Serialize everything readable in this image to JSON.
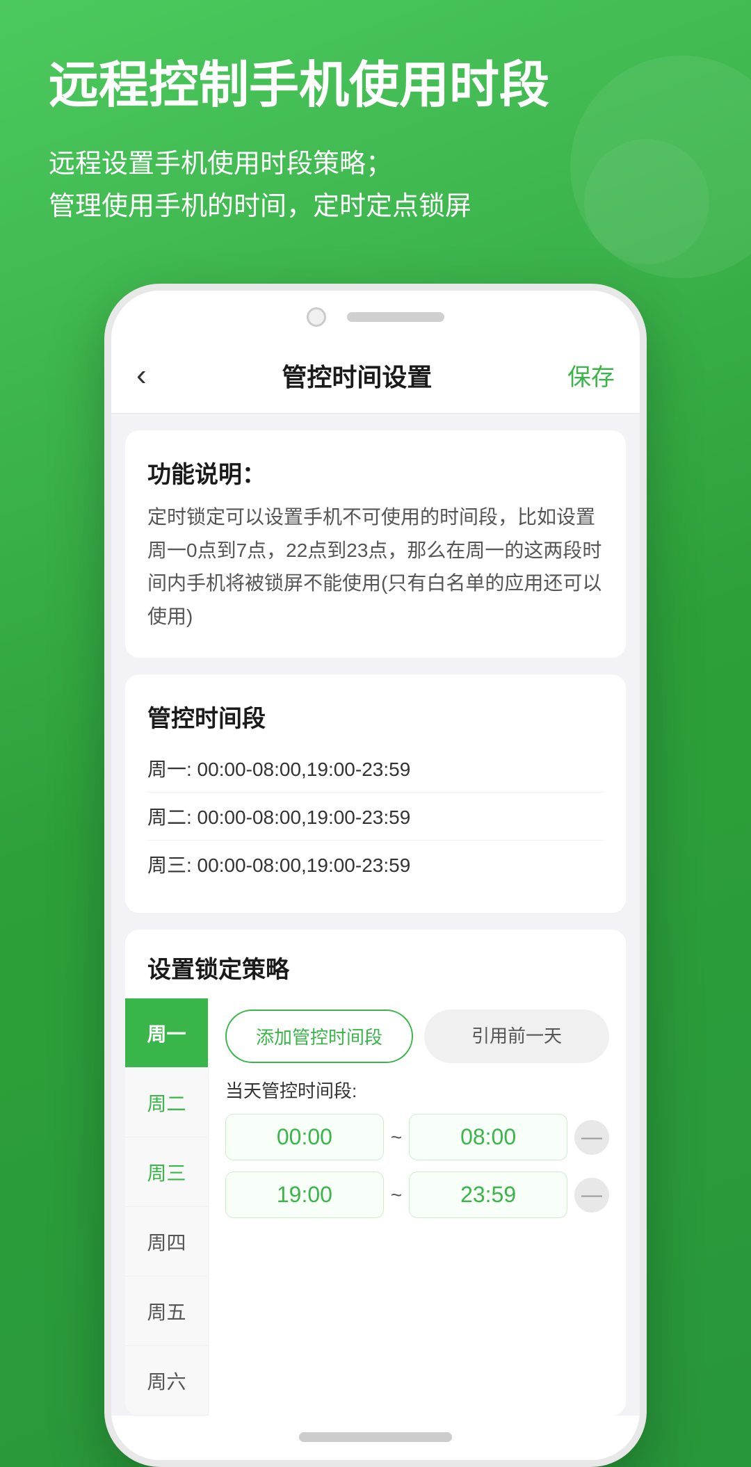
{
  "hero": {
    "title": "远程控制手机使用时段",
    "desc_line1": "远程设置手机使用时段策略；",
    "desc_line2": "管理使用手机的时间，定时定点锁屏"
  },
  "app": {
    "navbar": {
      "back_icon": "‹",
      "title": "管控时间设置",
      "save_label": "保存"
    },
    "feature_card": {
      "title": "功能说明：",
      "desc": "定时锁定可以设置手机不可使用的时间段，比如设置周一0点到7点，22点到23点，那么在周一的这两段时间内手机将被锁屏不能使用(只有白名单的应用还可以使用)"
    },
    "control_times_card": {
      "title": "管控时间段",
      "items": [
        {
          "label": "周一: 00:00-08:00,19:00-23:59"
        },
        {
          "label": "周二: 00:00-08:00,19:00-23:59"
        },
        {
          "label": "周三: 00:00-08:00,19:00-23:59"
        }
      ]
    },
    "strategy_card": {
      "title": "设置锁定策略",
      "days": [
        {
          "label": "周一",
          "active": true,
          "has_data": false
        },
        {
          "label": "周二",
          "active": false,
          "has_data": true
        },
        {
          "label": "周三",
          "active": false,
          "has_data": true
        },
        {
          "label": "周四",
          "active": false,
          "has_data": false
        },
        {
          "label": "周五",
          "active": false,
          "has_data": false
        },
        {
          "label": "周六",
          "active": false,
          "has_data": false
        }
      ],
      "panel": {
        "add_btn": "添加管控时间段",
        "copy_btn": "引用前一天",
        "day_label": "当天管控时间段:",
        "ranges": [
          {
            "start": "00:00",
            "end": "08:00"
          },
          {
            "start": "19:00",
            "end": "23:59"
          }
        ],
        "remove_icon": "—"
      }
    }
  }
}
